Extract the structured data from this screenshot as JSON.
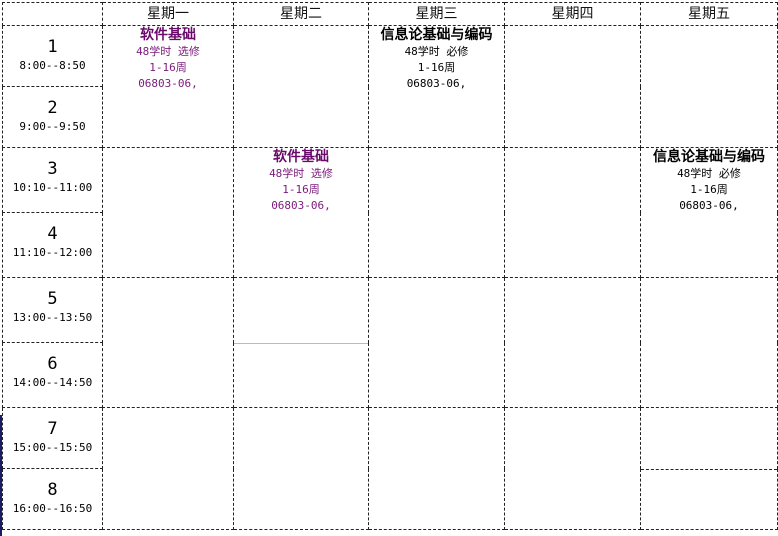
{
  "days": [
    "星期一",
    "星期二",
    "星期三",
    "星期四",
    "星期五"
  ],
  "periods": [
    {
      "num": "1",
      "time": "8:00--8:50"
    },
    {
      "num": "2",
      "time": "9:00--9:50"
    },
    {
      "num": "3",
      "time": "10:10--11:00"
    },
    {
      "num": "4",
      "time": "11:10--12:00"
    },
    {
      "num": "5",
      "time": "13:00--13:50"
    },
    {
      "num": "6",
      "time": "14:00--14:50"
    },
    {
      "num": "7",
      "time": "15:00--15:50"
    },
    {
      "num": "8",
      "time": "16:00--16:50"
    }
  ],
  "courses": {
    "mon_12": {
      "name": "软件基础",
      "hours": "48学时 选修",
      "weeks": "1-16周",
      "room": "06803-06,"
    },
    "wed_12": {
      "name": "信息论基础与编码",
      "hours": "48学时 必修",
      "weeks": "1-16周",
      "room": "06803-06,"
    },
    "tue_34": {
      "name": "软件基础",
      "hours": "48学时 选修",
      "weeks": "1-16周",
      "room": "06803-06,"
    },
    "fri_34": {
      "name": "信息论基础与编码",
      "hours": "48学时 必修",
      "weeks": "1-16周",
      "room": "06803-06,"
    }
  },
  "colors": {
    "elective": "#6a0a6a",
    "required": "#000000",
    "border": "#222222"
  }
}
